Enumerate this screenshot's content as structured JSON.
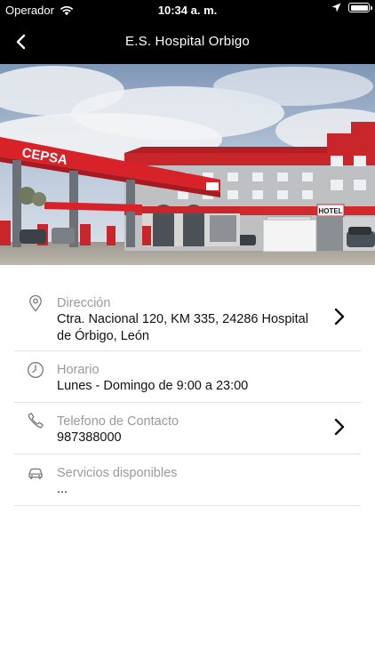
{
  "status_bar": {
    "carrier": "Operador",
    "time": "10:34 a. m."
  },
  "nav": {
    "title": "E.S. Hospital Orbigo",
    "back_icon": "chevron-left-icon"
  },
  "hero": {
    "description_icon": "gas-station-photo",
    "brand_sign": "CEPSA",
    "hotel_sign": "HOTEL",
    "colors": {
      "brand_red": "#d8222a",
      "sky": "#9fb6d3"
    }
  },
  "details": [
    {
      "icon": "location-pin-icon",
      "label": "Dirección",
      "value": "Ctra. Nacional 120, KM 335, 24286 Hospital de Órbigo, León",
      "has_chevron": true
    },
    {
      "icon": "clock-icon",
      "label": "Horario",
      "value": "Lunes - Domingo de 9:00 a 23:00",
      "has_chevron": false
    },
    {
      "icon": "phone-icon",
      "label": "Telefono de Contacto",
      "value": "987388000",
      "has_chevron": true
    },
    {
      "icon": "car-icon",
      "label": "Servicios disponibles",
      "value": "...",
      "has_chevron": false
    }
  ]
}
